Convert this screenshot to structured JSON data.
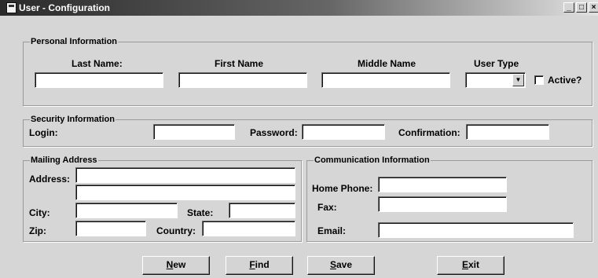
{
  "window": {
    "title": "User - Configuration",
    "controls": {
      "minimize": "_",
      "maximize": "□"
    }
  },
  "personal": {
    "legend": "Personal Information",
    "last_name_label": "Last Name:",
    "first_name_label": "First Name",
    "middle_name_label": "Middle Name",
    "user_type_label": "User Type",
    "active_label": "Active?",
    "last_name_value": "",
    "first_name_value": "",
    "middle_name_value": "",
    "user_type_value": "",
    "active_checked": false
  },
  "security": {
    "legend": "Security Information",
    "login_label": "Login:",
    "password_label": "Password:",
    "confirmation_label": "Confirmation:",
    "login_value": "",
    "password_value": "",
    "confirmation_value": ""
  },
  "mailing": {
    "legend": "Mailing Address",
    "address_label": "Address:",
    "city_label": "City:",
    "state_label": "State:",
    "zip_label": "Zip:",
    "country_label": "Country:",
    "address1_value": "",
    "address2_value": "",
    "city_value": "",
    "state_value": "",
    "zip_value": "",
    "country_value": ""
  },
  "communication": {
    "legend": "Communication Information",
    "home_phone_label": "Home Phone:",
    "fax_label": "Fax:",
    "email_label": "Email:",
    "home_phone_value": "",
    "fax_value": "",
    "email_value": ""
  },
  "buttons": {
    "new": {
      "key": "N",
      "rest": "ew"
    },
    "find": {
      "key": "F",
      "rest": "ind"
    },
    "save": {
      "key": "S",
      "rest": "ave"
    },
    "exit": {
      "key": "E",
      "rest": "xit"
    }
  }
}
